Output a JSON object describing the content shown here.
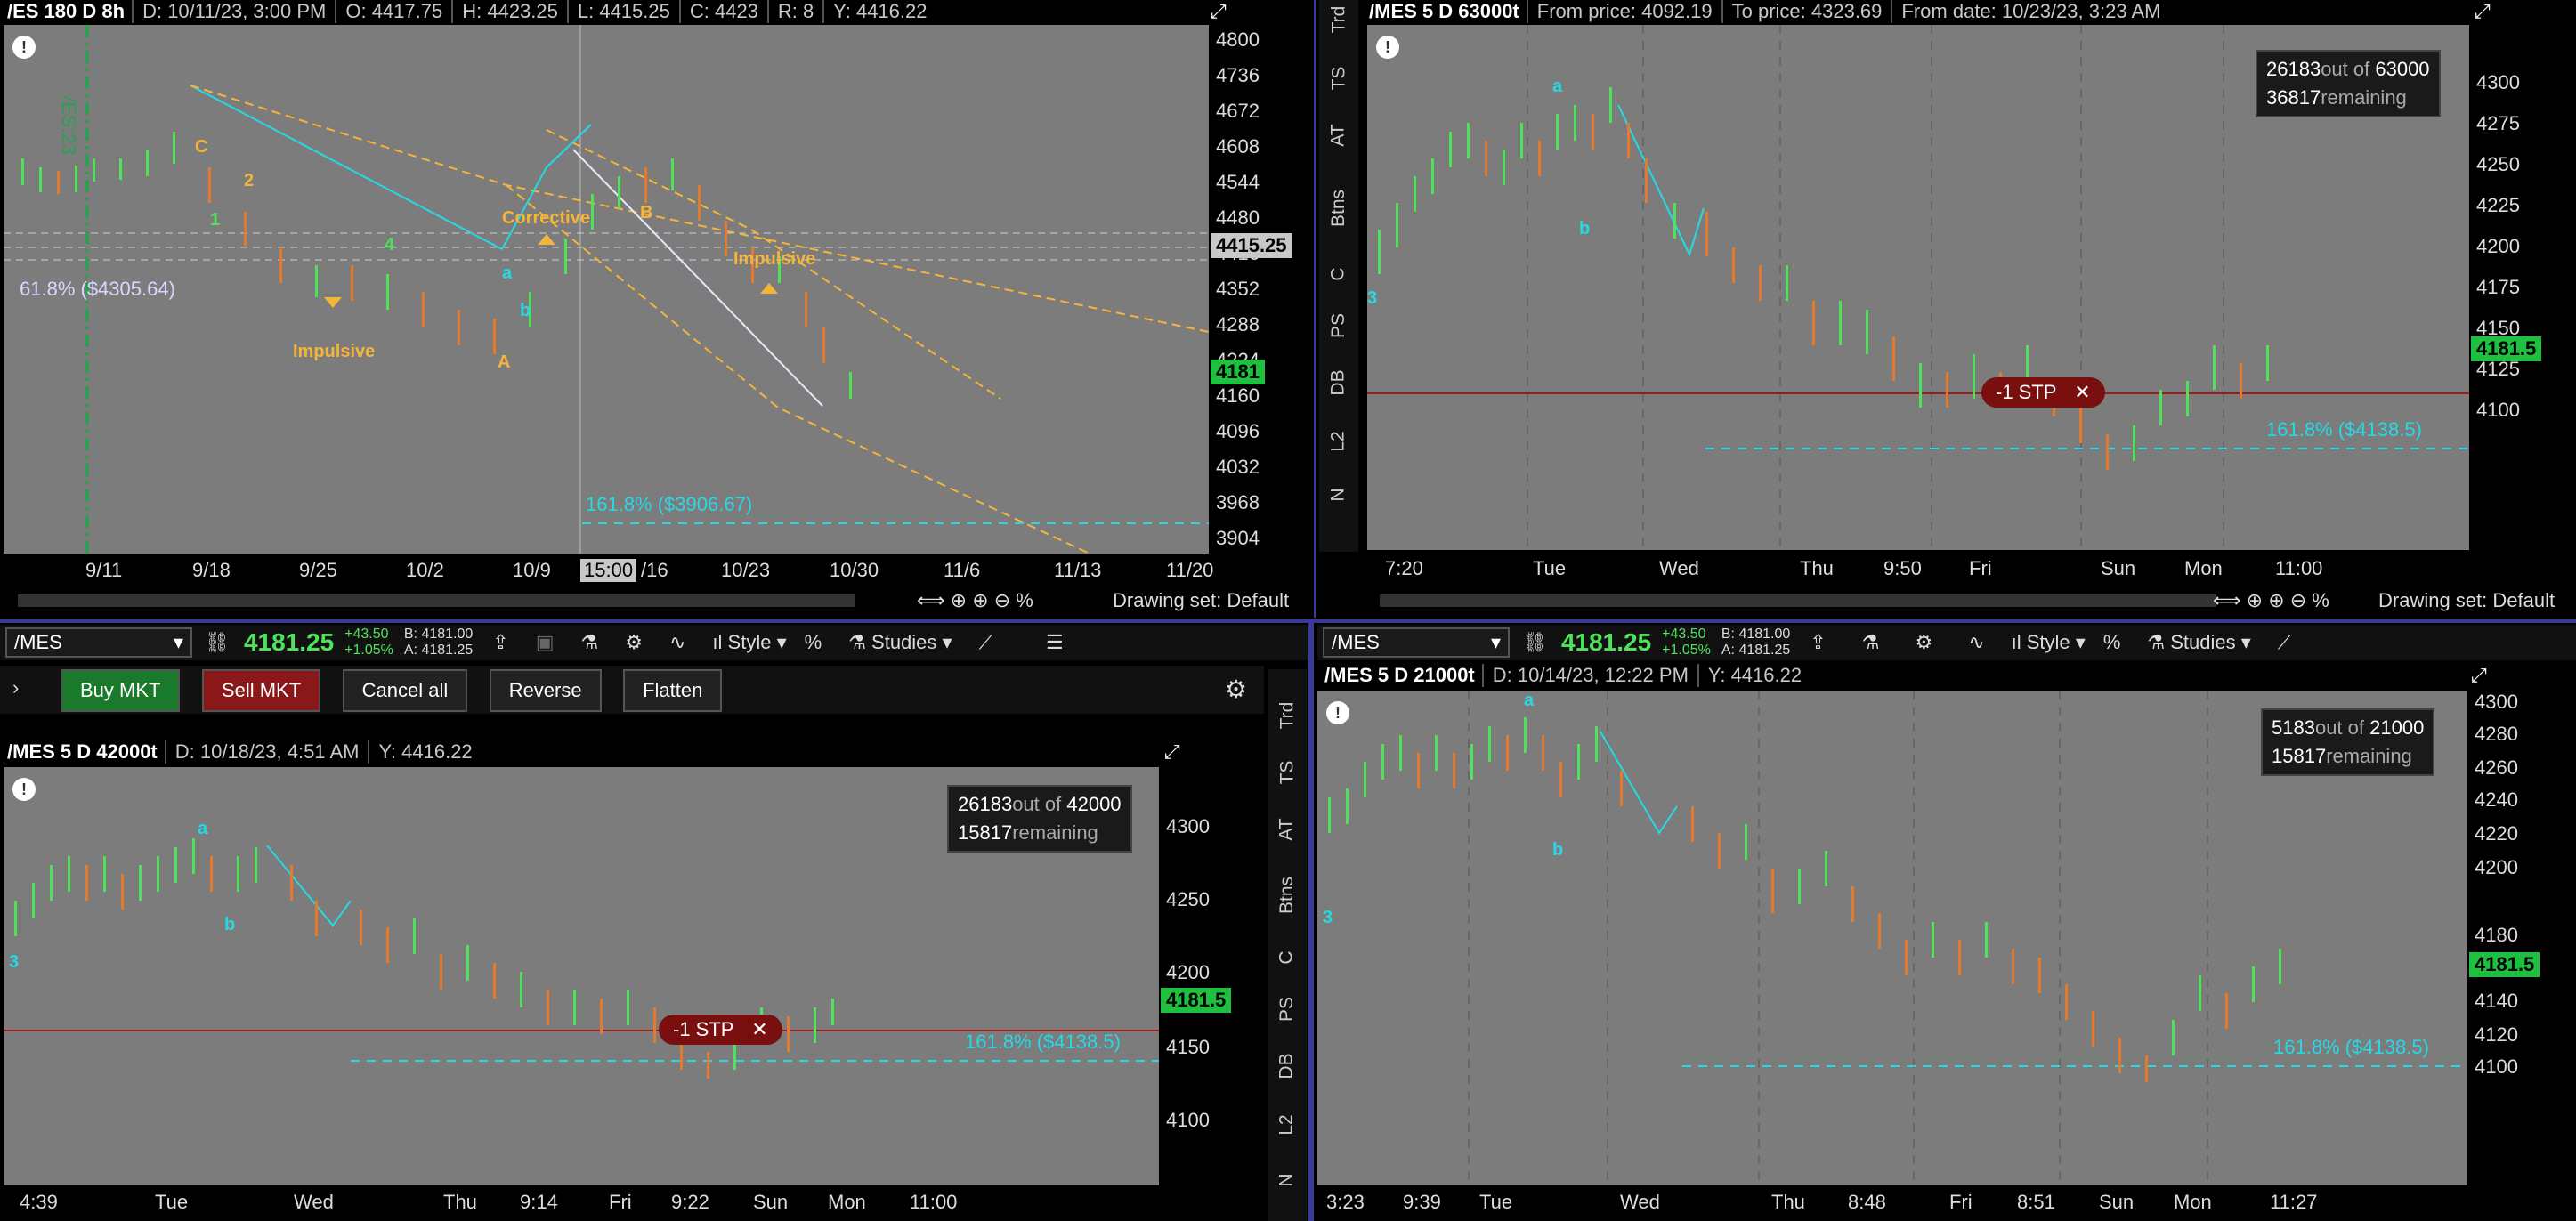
{
  "tl": {
    "header": {
      "title": "/ES 180 D 8h",
      "date": "D: 10/11/23, 3:00 PM",
      "open": "O: 4417.75",
      "high": "H: 4423.25",
      "low": "L: 4415.25",
      "close": "C: 4423",
      "range": "R: 8",
      "y": "Y: 4416.22"
    },
    "yaxis": [
      "4800",
      "4736",
      "4672",
      "4608",
      "4544",
      "4480",
      "4416",
      "4352",
      "4288",
      "4224",
      "4160",
      "4096",
      "4032",
      "3968",
      "3904"
    ],
    "xaxis": [
      "9/11",
      "9/18",
      "9/25",
      "10/2",
      "10/9",
      "15:00",
      "/16",
      "10/23",
      "10/30",
      "11/6",
      "11/13",
      "11/20"
    ],
    "price_tag": "4181",
    "cursor_tag": "4415.25",
    "fib1": "61.8%  ($4305.64)",
    "fib2": "161.8%  ($3906.67)",
    "labels": {
      "impulsive1": "Impulsive",
      "corrective": "Corrective",
      "impulsive2": "Impulsive",
      "c": "C",
      "a": "A",
      "b": "B",
      "one": "1",
      "two": "2",
      "four": "4",
      "sa": "a",
      "sb": "b",
      "symbol_vert": "/ES:23"
    },
    "drawing_set": "Drawing set: Default"
  },
  "tr": {
    "header": {
      "title": "/MES 5 D 63000t",
      "from_price": "From price: 4092.19",
      "to_price": "To price: 4323.69",
      "from_date": "From date: 10/23/23, 3:23 AM"
    },
    "yaxis": [
      "4300",
      "4275",
      "4250",
      "4225",
      "4200",
      "4175",
      "4150",
      "4125",
      "4100"
    ],
    "xaxis": [
      "7:20",
      "Tue",
      "Wed",
      "Thu",
      "9:50",
      "Fri",
      "Sun",
      "Mon",
      "11:00"
    ],
    "info_count": "26183",
    "info_out": "out of",
    "info_total": "63000",
    "info_rem": "36817",
    "info_rem_label": "remaining",
    "price_tag": "4181.5",
    "stp": "-1 STP",
    "fib": "161.8%  ($4138.5)",
    "labels": {
      "a": "a",
      "b": "b",
      "three": "3"
    },
    "drawing_set": "Drawing set: Default"
  },
  "sidebar_tabs": [
    "Trd",
    "TS",
    "AT",
    "Btns",
    "C",
    "PS",
    "DB",
    "L2",
    "N"
  ],
  "bl": {
    "symbol": "/MES",
    "last": "4181.25",
    "change": "+43.50",
    "change_pct": "+1.05%",
    "bid": "B: 4181.00",
    "ask": "A: 4181.25",
    "style": "Style",
    "studies": "Studies",
    "buttons": {
      "buy": "Buy MKT",
      "sell": "Sell MKT",
      "cancel": "Cancel all",
      "reverse": "Reverse",
      "flatten": "Flatten"
    },
    "header": {
      "title": "/MES 5 D 42000t",
      "date": "D: 10/18/23, 4:51 AM",
      "y": "Y: 4416.22"
    },
    "yaxis": [
      "4300",
      "4250",
      "4200",
      "4150",
      "4100"
    ],
    "xaxis": [
      "4:39",
      "Tue",
      "Wed",
      "Thu",
      "9:14",
      "Fri",
      "9:22",
      "Sun",
      "Mon",
      "11:00"
    ],
    "info_count": "26183",
    "info_out": "out of",
    "info_total": "42000",
    "info_rem": "15817",
    "info_rem_label": "remaining",
    "price_tag": "4181.5",
    "stp": "-1 STP",
    "fib": "161.8%  ($4138.5)",
    "labels": {
      "a": "a",
      "b": "b",
      "three": "3"
    }
  },
  "br": {
    "symbol": "/MES",
    "last": "4181.25",
    "change": "+43.50",
    "change_pct": "+1.05%",
    "bid": "B: 4181.00",
    "ask": "A: 4181.25",
    "style": "Style",
    "studies": "Studies",
    "header": {
      "title": "/MES 5 D 21000t",
      "date": "D: 10/14/23, 12:22 PM",
      "y": "Y: 4416.22"
    },
    "yaxis": [
      "4300",
      "4280",
      "4260",
      "4240",
      "4220",
      "4200",
      "4180",
      "4160",
      "4140",
      "4120",
      "4100"
    ],
    "xaxis": [
      "3:23",
      "9:39",
      "Tue",
      "Wed",
      "Thu",
      "8:48",
      "Fri",
      "8:51",
      "Sun",
      "Mon",
      "11:27"
    ],
    "info_count": "5183",
    "info_out": "out of",
    "info_total": "21000",
    "info_rem": "15817",
    "info_rem_label": "remaining",
    "price_tag": "4181.5",
    "fib": "161.8%  ($4138.5)",
    "labels": {
      "a": "a",
      "b": "b",
      "three": "3"
    }
  },
  "colors": {
    "bull": "#4ee35a",
    "bear": "#e37a2e",
    "fib": "#25d9e6",
    "wave": "#f5b53b",
    "stop": "#7a0f0f"
  }
}
